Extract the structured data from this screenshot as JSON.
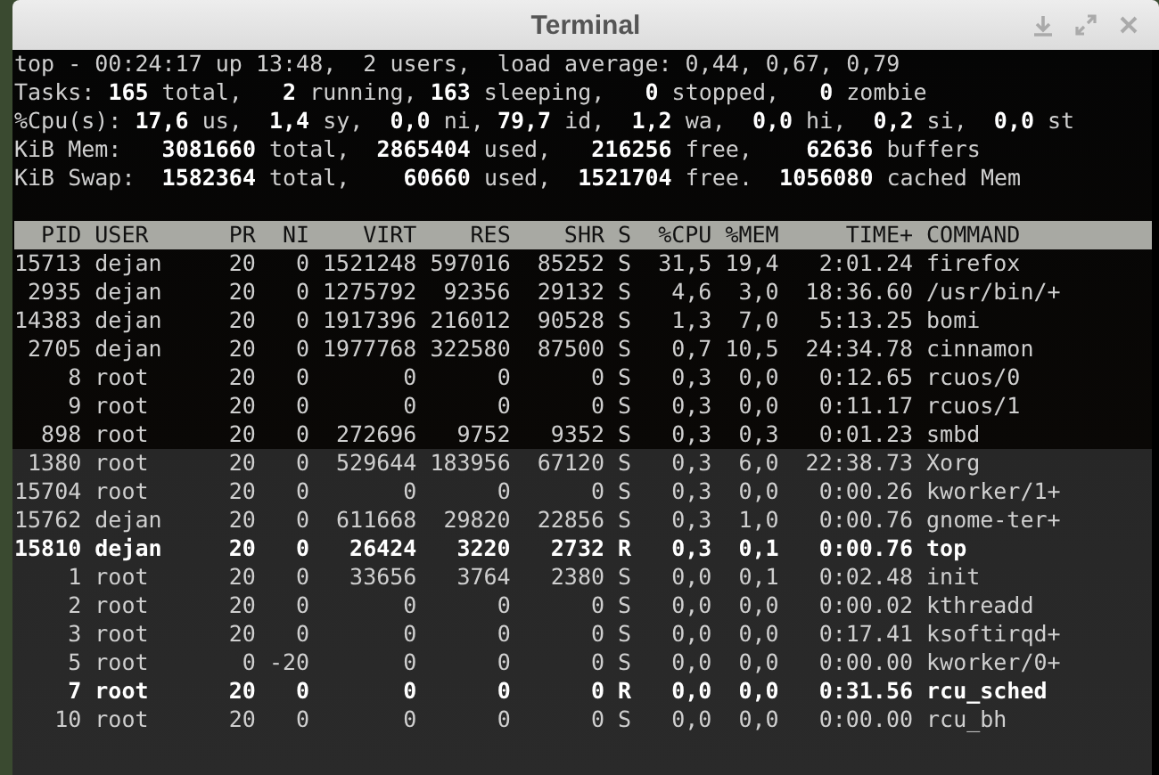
{
  "window": {
    "title": "Terminal"
  },
  "summary": [
    "top - 00:24:17 up 13:48,  2 users,  load average: 0,44, 0,67, 0,79",
    "Tasks: **165** total,   **2** running, **163** sleeping,   **0** stopped,   **0** zombie",
    "%Cpu(s): **17,6** us,  **1,4** sy,  **0,0** ni, **79,7** id,  **1,2** wa,  **0,0** hi,  **0,2** si,  **0,0** st",
    "KiB Mem:   **3081660** total,  **2865404** used,   **216256** free,    **62636** buffers",
    "KiB Swap:  **1582364** total,    **60660** used,  **1521704** free.  **1056080** cached Mem"
  ],
  "table": {
    "columns": [
      "PID",
      "USER",
      "PR",
      "NI",
      "VIRT",
      "RES",
      "SHR",
      "S",
      "%CPU",
      "%MEM",
      "TIME+",
      "COMMAND"
    ],
    "rows": [
      {
        "highlighted": false,
        "cells": [
          "15713",
          "dejan",
          "20",
          "0",
          "1521248",
          "597016",
          "85252",
          "S",
          "31,5",
          "19,4",
          "2:01.24",
          "firefox"
        ]
      },
      {
        "highlighted": false,
        "cells": [
          "2935",
          "dejan",
          "20",
          "0",
          "1275792",
          "92356",
          "29132",
          "S",
          "4,6",
          "3,0",
          "18:36.60",
          "/usr/bin/+"
        ]
      },
      {
        "highlighted": false,
        "cells": [
          "14383",
          "dejan",
          "20",
          "0",
          "1917396",
          "216012",
          "90528",
          "S",
          "1,3",
          "7,0",
          "5:13.25",
          "bomi"
        ]
      },
      {
        "highlighted": false,
        "cells": [
          "2705",
          "dejan",
          "20",
          "0",
          "1977768",
          "322580",
          "87500",
          "S",
          "0,7",
          "10,5",
          "24:34.78",
          "cinnamon"
        ]
      },
      {
        "highlighted": false,
        "cells": [
          "8",
          "root",
          "20",
          "0",
          "0",
          "0",
          "0",
          "S",
          "0,3",
          "0,0",
          "0:12.65",
          "rcuos/0"
        ]
      },
      {
        "highlighted": false,
        "cells": [
          "9",
          "root",
          "20",
          "0",
          "0",
          "0",
          "0",
          "S",
          "0,3",
          "0,0",
          "0:11.17",
          "rcuos/1"
        ]
      },
      {
        "highlighted": false,
        "cells": [
          "898",
          "root",
          "20",
          "0",
          "272696",
          "9752",
          "9352",
          "S",
          "0,3",
          "0,3",
          "0:01.23",
          "smbd"
        ]
      },
      {
        "highlighted": false,
        "cells": [
          "1380",
          "root",
          "20",
          "0",
          "529644",
          "183956",
          "67120",
          "S",
          "0,3",
          "6,0",
          "22:38.73",
          "Xorg"
        ]
      },
      {
        "highlighted": false,
        "cells": [
          "15704",
          "root",
          "20",
          "0",
          "0",
          "0",
          "0",
          "S",
          "0,3",
          "0,0",
          "0:00.26",
          "kworker/1+"
        ]
      },
      {
        "highlighted": false,
        "cells": [
          "15762",
          "dejan",
          "20",
          "0",
          "611668",
          "29820",
          "22856",
          "S",
          "0,3",
          "1,0",
          "0:00.76",
          "gnome-ter+"
        ]
      },
      {
        "highlighted": true,
        "cells": [
          "15810",
          "dejan",
          "20",
          "0",
          "26424",
          "3220",
          "2732",
          "R",
          "0,3",
          "0,1",
          "0:00.76",
          "top"
        ]
      },
      {
        "highlighted": false,
        "cells": [
          "1",
          "root",
          "20",
          "0",
          "33656",
          "3764",
          "2380",
          "S",
          "0,0",
          "0,1",
          "0:02.48",
          "init"
        ]
      },
      {
        "highlighted": false,
        "cells": [
          "2",
          "root",
          "20",
          "0",
          "0",
          "0",
          "0",
          "S",
          "0,0",
          "0,0",
          "0:00.02",
          "kthreadd"
        ]
      },
      {
        "highlighted": false,
        "cells": [
          "3",
          "root",
          "20",
          "0",
          "0",
          "0",
          "0",
          "S",
          "0,0",
          "0,0",
          "0:17.41",
          "ksoftirqd+"
        ]
      },
      {
        "highlighted": false,
        "cells": [
          "5",
          "root",
          "0",
          "-20",
          "0",
          "0",
          "0",
          "S",
          "0,0",
          "0,0",
          "0:00.00",
          "kworker/0+"
        ]
      },
      {
        "highlighted": true,
        "cells": [
          "7",
          "root",
          "20",
          "0",
          "0",
          "0",
          "0",
          "R",
          "0,0",
          "0,0",
          "0:31.56",
          "rcu_sched"
        ]
      },
      {
        "highlighted": false,
        "cells": [
          "10",
          "root",
          "20",
          "0",
          "0",
          "0",
          "0",
          "S",
          "0,0",
          "0,0",
          "0:00.00",
          "rcu_bh"
        ]
      }
    ]
  }
}
